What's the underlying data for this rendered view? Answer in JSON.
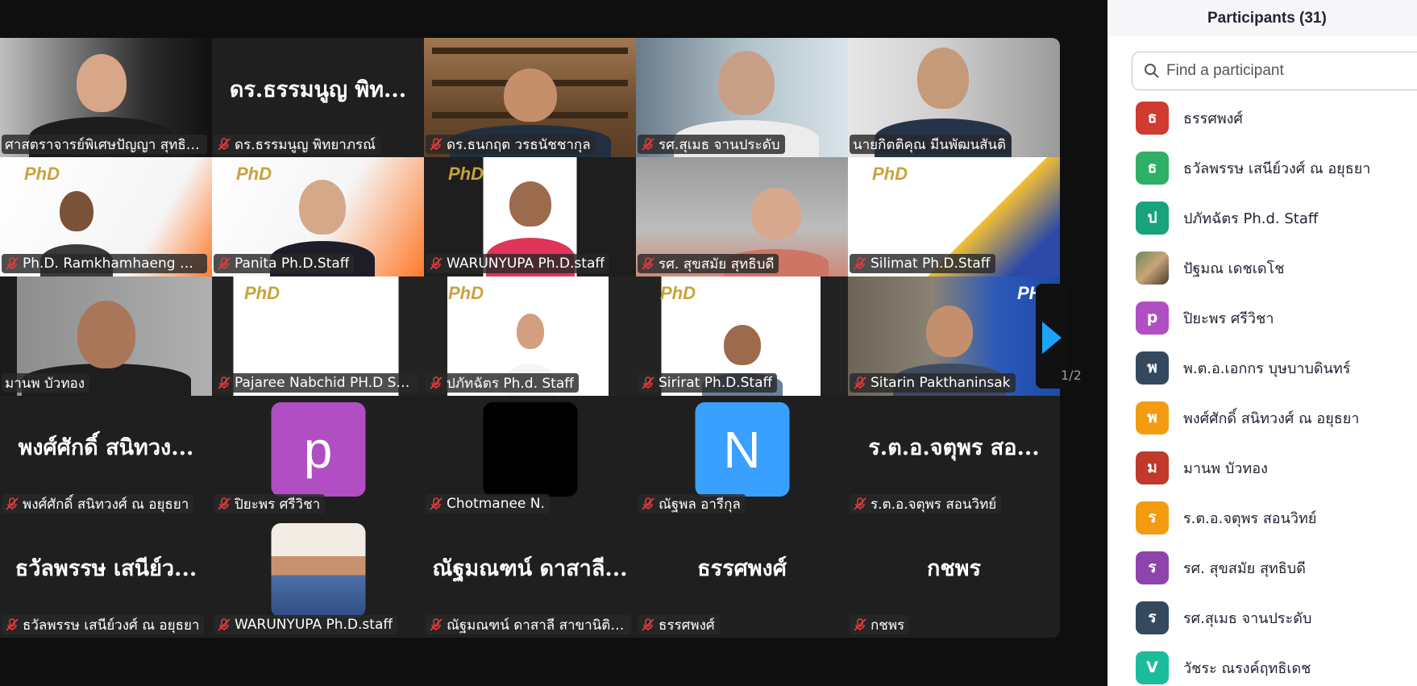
{
  "gallery": {
    "tiles": [
      {
        "name": "ศาสตราจารย์พิเศษปัญญา สุทธิบดี",
        "muted": false,
        "kind": "video"
      },
      {
        "name": "ดร.ธรรมนูญ พิทยาภรณ์",
        "muted": true,
        "kind": "name",
        "big": "ดร.ธรรมนูญ พิท..."
      },
      {
        "name": "ดร.ธนกฤต วรธนัชชากุล",
        "muted": true,
        "kind": "video"
      },
      {
        "name": "รศ.สุเมธ จานประดับ",
        "muted": true,
        "kind": "video"
      },
      {
        "name": "นายกิตติคุณ มีนพัฒนสันติ",
        "muted": false,
        "kind": "video"
      },
      {
        "name": "Ph.D. Ramkhamhaeng Un...",
        "muted": true,
        "kind": "video",
        "logo": "PhD"
      },
      {
        "name": "Panita Ph.D.Staff",
        "muted": true,
        "kind": "video",
        "logo": "PhD"
      },
      {
        "name": "WARUNYUPA Ph.D.staff",
        "muted": true,
        "kind": "video",
        "logo": "PhD"
      },
      {
        "name": "รศ. สุขสมัย สุทธิบดี",
        "muted": true,
        "kind": "video"
      },
      {
        "name": "Silimat Ph.D.Staff",
        "muted": true,
        "kind": "video",
        "logo": "PhD"
      },
      {
        "name": "มานพ บัวทอง",
        "muted": false,
        "kind": "video"
      },
      {
        "name": "Pajaree Nabchid PH.D Staff",
        "muted": true,
        "kind": "video",
        "logo": "PhD"
      },
      {
        "name": "ปภัทฉัตร Ph.d. Staff",
        "muted": true,
        "kind": "video",
        "logo": "PhD"
      },
      {
        "name": "Sirirat Ph.D.Staff",
        "muted": true,
        "kind": "video",
        "logo": "PhD"
      },
      {
        "name": "Sitarin Pakthaninsak",
        "muted": true,
        "kind": "video",
        "logo": "PH"
      },
      {
        "name": "พงศ์ศักดิ์ สนิทวงศ์ ณ อยุธยา",
        "muted": true,
        "kind": "name",
        "big": "พงศ์ศักดิ์ สนิทวง..."
      },
      {
        "name": "ปิยะพร ศรีวิชา",
        "muted": true,
        "kind": "avatar",
        "letter": "p",
        "color": "#b14ec3"
      },
      {
        "name": "Chotmanee N.",
        "muted": true,
        "kind": "avatar",
        "letter": "",
        "color": "#000000"
      },
      {
        "name": "ณัฐพล อารีกุล",
        "muted": true,
        "kind": "avatar",
        "letter": "N",
        "color": "#3aa0ff"
      },
      {
        "name": "ร.ต.อ.จตุพร  สอนวิทย์",
        "muted": true,
        "kind": "name",
        "big": "ร.ต.อ.จตุพร  สอ..."
      },
      {
        "name": "ธวัลพรรษ เสนีย์วงศ์ ณ อยุธยา",
        "muted": true,
        "kind": "name",
        "big": "ธวัลพรรษ เสนีย์ว..."
      },
      {
        "name": "WARUNYUPA Ph.D.staff",
        "muted": true,
        "kind": "photo"
      },
      {
        "name": "ณัฐมณฑน์ ดาสาลี สาขานิติศ...",
        "muted": true,
        "kind": "name",
        "big": "ณัฐมณฑน์ ดาสาลี..."
      },
      {
        "name": "ธรรศพงศ์",
        "muted": true,
        "kind": "name",
        "big": "ธรรศพงศ์"
      },
      {
        "name": "กชพร",
        "muted": true,
        "kind": "name",
        "big": "กชพร"
      }
    ],
    "page_indicator": "1/2"
  },
  "participants": {
    "title": "Participants (31)",
    "search_placeholder": "Find a participant",
    "items": [
      {
        "initial": "ธ",
        "name": "ธรรศพงศ์",
        "color": "#d03a2f"
      },
      {
        "initial": "ธ",
        "name": "ธวัลพรรษ เสนีย์วงศ์ ณ อยุธยา",
        "color": "#2eb165"
      },
      {
        "initial": "ป",
        "name": "ปภัทฉัตร Ph.d. Staff",
        "color": "#18a37c"
      },
      {
        "initial": "",
        "name": "ปัฐมณ เดชเดโช",
        "color": "#8a6a4a",
        "photo": true
      },
      {
        "initial": "p",
        "name": "ปิยะพร ศรีวิชา",
        "color": "#b14ec3"
      },
      {
        "initial": "พ",
        "name": "พ.ต.อ.เอกกร บุษบาบดินทร์",
        "color": "#34495e"
      },
      {
        "initial": "พ",
        "name": "พงศ์ศักดิ์ สนิทวงศ์ ณ อยุธยา",
        "color": "#f39c12"
      },
      {
        "initial": "ม",
        "name": "มานพ บัวทอง",
        "color": "#c0392b"
      },
      {
        "initial": "ร",
        "name": "ร.ต.อ.จตุพร  สอนวิทย์",
        "color": "#f39c12"
      },
      {
        "initial": "ร",
        "name": "รศ. สุขสมัย สุทธิบดี",
        "color": "#8e44ad"
      },
      {
        "initial": "ร",
        "name": "รศ.สุเมธ จานประดับ",
        "color": "#34495e"
      },
      {
        "initial": "V",
        "name": "วัชระ ณรงค์ฤทธิเดช",
        "color": "#1abc9c"
      }
    ]
  }
}
